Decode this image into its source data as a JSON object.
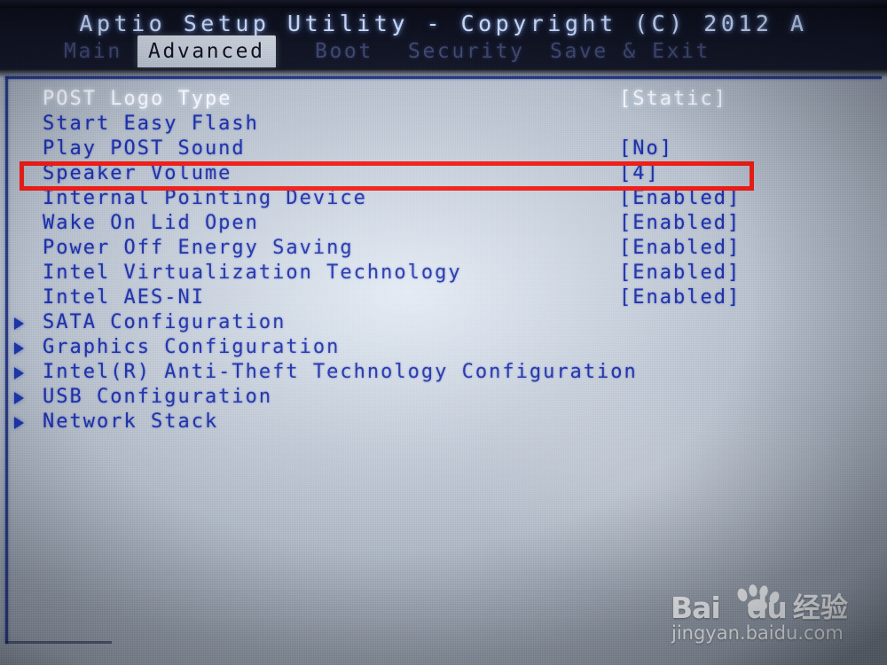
{
  "header": {
    "title": "Aptio Setup Utility - Copyright (C) 2012 A",
    "tabs": [
      {
        "label": "Main",
        "active": false
      },
      {
        "label": "Advanced",
        "active": true
      },
      {
        "label": "Boot",
        "active": false
      },
      {
        "label": "Security",
        "active": false
      },
      {
        "label": "Save & Exit",
        "active": false
      }
    ]
  },
  "menu": {
    "rows": [
      {
        "label": "POST Logo Type",
        "value": "[Static]",
        "submenu": false,
        "selected": true
      },
      {
        "label": "Start Easy Flash",
        "value": "",
        "submenu": false,
        "selected": false
      },
      {
        "label": "Play POST Sound",
        "value": "[No]",
        "submenu": false,
        "selected": false
      },
      {
        "label": "Speaker Volume",
        "value": "[4]",
        "submenu": false,
        "selected": false
      },
      {
        "label": "Internal Pointing Device",
        "value": "[Enabled]",
        "submenu": false,
        "selected": false
      },
      {
        "label": "Wake On Lid Open",
        "value": "[Enabled]",
        "submenu": false,
        "selected": false
      },
      {
        "label": "Power Off Energy Saving",
        "value": "[Enabled]",
        "submenu": false,
        "selected": false
      },
      {
        "label": "Intel Virtualization Technology",
        "value": "[Enabled]",
        "submenu": false,
        "selected": false
      },
      {
        "label": "Intel AES-NI",
        "value": "[Enabled]",
        "submenu": false,
        "selected": false
      },
      {
        "label": "SATA Configuration",
        "value": "",
        "submenu": true,
        "selected": false
      },
      {
        "label": "Graphics Configuration",
        "value": "",
        "submenu": true,
        "selected": false
      },
      {
        "label": "Intel(R) Anti-Theft Technology Configuration",
        "value": "",
        "submenu": true,
        "selected": false
      },
      {
        "label": "USB Configuration",
        "value": "",
        "submenu": true,
        "selected": false
      },
      {
        "label": "Network Stack",
        "value": "",
        "submenu": true,
        "selected": false
      }
    ]
  },
  "annotation": {
    "highlight_color": "#ef1c15",
    "highlighted_row_label": "Speaker Volume",
    "highlighted_row_value": "[4]"
  },
  "watermark": {
    "brand_bai": "Bai",
    "brand_du": "du",
    "brand_cn": "经验",
    "url": "jingyan.baidu.com"
  },
  "colors": {
    "screen_bg": "#b9c2ce",
    "header_bg": "#0b0d19",
    "menu_text": "#1d2fa6",
    "selected_text": "#f2f6ff",
    "tab_active_bg": "#c8cfdb",
    "annotation_red": "#ef1c15"
  }
}
